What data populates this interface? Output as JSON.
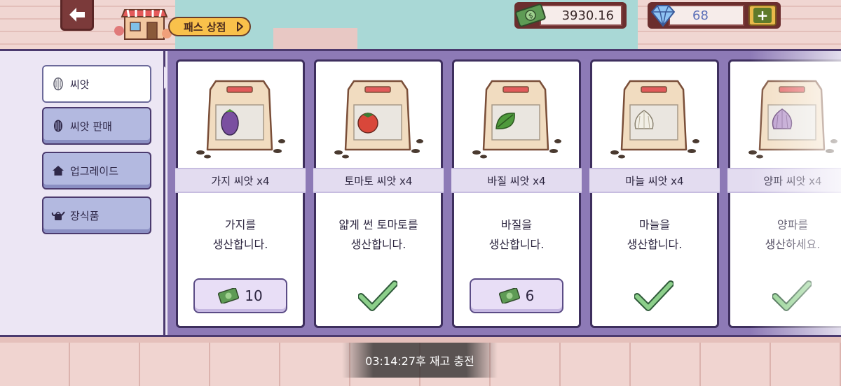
{
  "header": {
    "pass_label": "패스 상점",
    "money": "3930.16",
    "gems": "68",
    "plus_label": "+"
  },
  "sidebar": {
    "items": [
      {
        "label": "씨앗",
        "icon": "seed-icon",
        "active": true
      },
      {
        "label": "씨앗 판매",
        "icon": "seed-icon",
        "active": false
      },
      {
        "label": "업그레이드",
        "icon": "home-icon",
        "active": false
      },
      {
        "label": "장식품",
        "icon": "watering-can-icon",
        "active": false
      }
    ]
  },
  "cards": [
    {
      "name": "가지 씨앗 x4",
      "desc": "가지를\n생산합니다.",
      "price": "10",
      "owned": false,
      "veg": "eggplant",
      "veg_color": "#7a4fa0"
    },
    {
      "name": "토마토 씨앗 x4",
      "desc": "얇게 썬 토마토를\n생산합니다.",
      "price": null,
      "owned": true,
      "veg": "tomato",
      "veg_color": "#d9473a"
    },
    {
      "name": "바질 씨앗 x4",
      "desc": "바질을\n생산합니다.",
      "price": "6",
      "owned": false,
      "veg": "basil",
      "veg_color": "#4f9a3c"
    },
    {
      "name": "마늘 씨앗 x4",
      "desc": "마늘을\n생산합니다.",
      "price": null,
      "owned": true,
      "veg": "garlic",
      "veg_color": "#f2efe6"
    },
    {
      "name": "양파 씨앗 x4",
      "desc": "양파를\n생산하세요.",
      "price": null,
      "owned": true,
      "veg": "onion",
      "veg_color": "#b493c9"
    }
  ],
  "restock_timer": "03:14:27후 재고 충전",
  "colors": {
    "panel_bg": "#ece6f4",
    "cards_bg": "#8d7ab6",
    "border": "#3e2f5e",
    "check": "#8ccf8a",
    "money_green": "#5e9b55"
  }
}
